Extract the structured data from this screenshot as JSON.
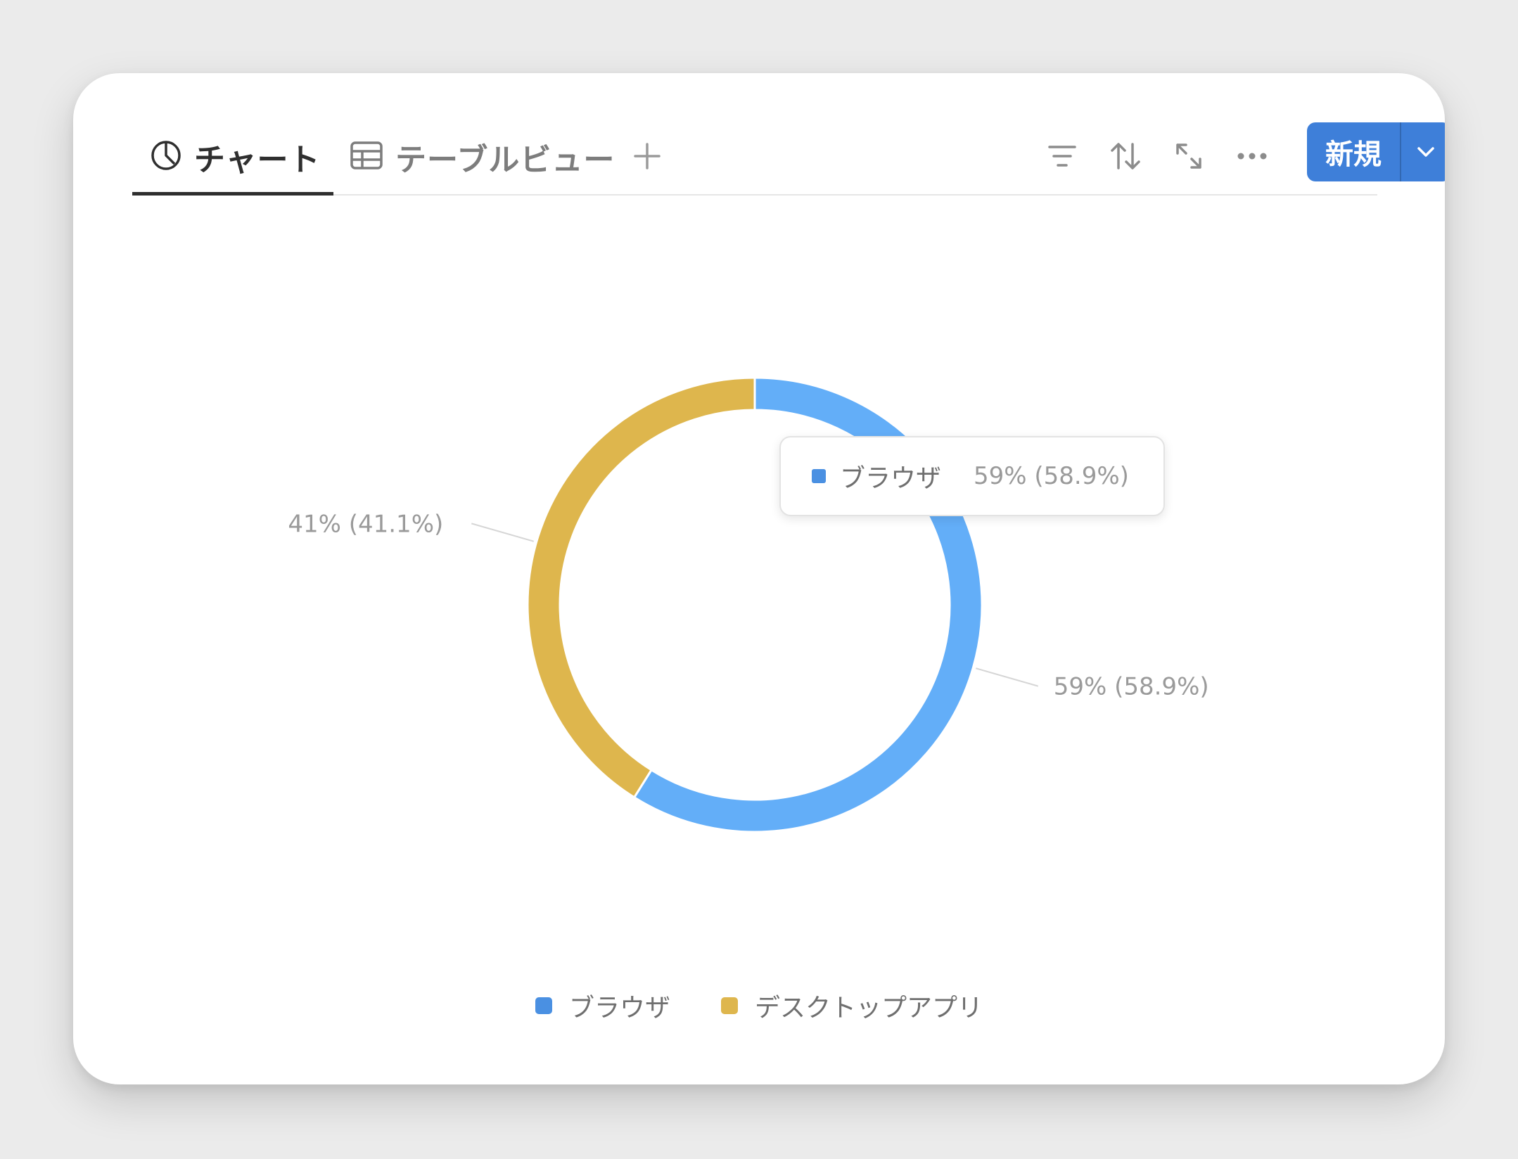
{
  "tabs": {
    "chart_label": "チャート",
    "table_label": "テーブルビュー"
  },
  "toolbar": {
    "new_label": "新規",
    "icons": [
      "filter-icon",
      "sort-icon",
      "expand-icon",
      "more-icon",
      "chevron-down-icon"
    ]
  },
  "tooltip": {
    "name": "ブラウザ",
    "value": "59% (58.9%)",
    "color": "#4a90e2"
  },
  "colors": {
    "accent": "#3e7fd9"
  },
  "chart_data": {
    "type": "pie",
    "donut": true,
    "title": "",
    "series": [
      {
        "name": "ブラウザ",
        "value": 58.9,
        "label": "59% (58.9%)",
        "color": "#63aef8",
        "legend_color": "#4a90e2"
      },
      {
        "name": "デスクトップアプリ",
        "value": 41.1,
        "label": "41% (41.1%)",
        "color": "#deb64d",
        "legend_color": "#deb64d"
      }
    ],
    "legend_position": "bottom"
  }
}
